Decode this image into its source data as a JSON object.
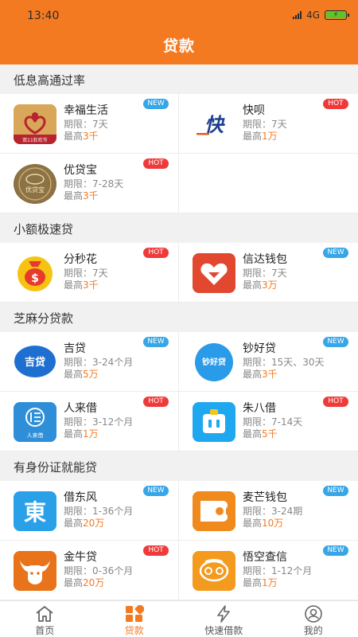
{
  "status_bar": {
    "time": "13:40",
    "network": "4G",
    "network_sup": "ill"
  },
  "header": {
    "title": "贷款"
  },
  "colors": {
    "accent": "#f47a22",
    "new_badge": "#37a6e6",
    "hot_badge": "#ef3a3a"
  },
  "sections": [
    {
      "title": "低息高通过率",
      "items": [
        {
          "name": "幸福生活",
          "term": "期限：7天",
          "max_prefix": "最高",
          "max_value": "3千",
          "badge": "NEW",
          "icon": "happy-life-logo-icon",
          "logo_text": "双11狂欢节"
        },
        {
          "name": "快呗",
          "term": "期限：7天",
          "max_prefix": "最高",
          "max_value": "1万",
          "badge": "HOT",
          "icon": "kuaibei-logo-icon",
          "logo_text": "快"
        },
        {
          "name": "优贷宝",
          "term": "期限：7-28天",
          "max_prefix": "最高",
          "max_value": "3千",
          "badge": "HOT",
          "icon": "youdaibao-logo-icon",
          "logo_text": "优贷宝"
        }
      ]
    },
    {
      "title": "小额极速贷",
      "items": [
        {
          "name": "分秒花",
          "term": "期限：7天",
          "max_prefix": "最高",
          "max_value": "3千",
          "badge": "HOT",
          "icon": "money-bag-logo-icon",
          "logo_text": "$"
        },
        {
          "name": "信达钱包",
          "term": "期限：7天",
          "max_prefix": "最高",
          "max_value": "3万",
          "badge": "NEW",
          "icon": "xinda-wallet-logo-icon",
          "logo_text": ""
        }
      ]
    },
    {
      "title": "芝麻分贷款",
      "items": [
        {
          "name": "吉贷",
          "term": "期限：3-24个月",
          "max_prefix": "最高",
          "max_value": "5万",
          "badge": "NEW",
          "icon": "jidai-logo-icon",
          "logo_text": "吉贷"
        },
        {
          "name": "钞好贷",
          "term": "期限：15天、30天",
          "max_prefix": "最高",
          "max_value": "3千",
          "badge": "NEW",
          "icon": "chaohaodai-logo-icon",
          "logo_text": "钞好贷"
        },
        {
          "name": "人来借",
          "term": "期限：3-12个月",
          "max_prefix": "最高",
          "max_value": "1万",
          "badge": "HOT",
          "icon": "renlaijie-logo-icon",
          "logo_text": "人来借"
        },
        {
          "name": "朱八借",
          "term": "期限：7-14天",
          "max_prefix": "最高",
          "max_value": "5千",
          "badge": "HOT",
          "icon": "zhubajie-logo-icon",
          "logo_text": ""
        }
      ]
    },
    {
      "title": "有身份证就能贷",
      "items": [
        {
          "name": "借东风",
          "term": "期限：1-36个月",
          "max_prefix": "最高",
          "max_value": "20万",
          "badge": "NEW",
          "icon": "jiedongfeng-logo-icon",
          "logo_text": "東"
        },
        {
          "name": "麦芒钱包",
          "term": "期限：3-24期",
          "max_prefix": "最高",
          "max_value": "10万",
          "badge": "NEW",
          "icon": "maimang-wallet-logo-icon",
          "logo_text": ""
        },
        {
          "name": "金牛贷",
          "term": "期限：0-36个月",
          "max_prefix": "最高",
          "max_value": "20万",
          "badge": "HOT",
          "icon": "jinniu-logo-icon",
          "logo_text": ""
        },
        {
          "name": "悟空查信",
          "term": "期限：1-12个月",
          "max_prefix": "最高",
          "max_value": "1万",
          "badge": "NEW",
          "icon": "wukong-logo-icon",
          "logo_text": ""
        }
      ]
    }
  ],
  "tabbar": [
    {
      "label": "首页",
      "icon": "home-icon",
      "active": false
    },
    {
      "label": "贷款",
      "icon": "loan-grid-icon",
      "active": true
    },
    {
      "label": "快速借款",
      "icon": "lightning-icon",
      "active": false
    },
    {
      "label": "我的",
      "icon": "profile-icon",
      "active": false
    }
  ]
}
